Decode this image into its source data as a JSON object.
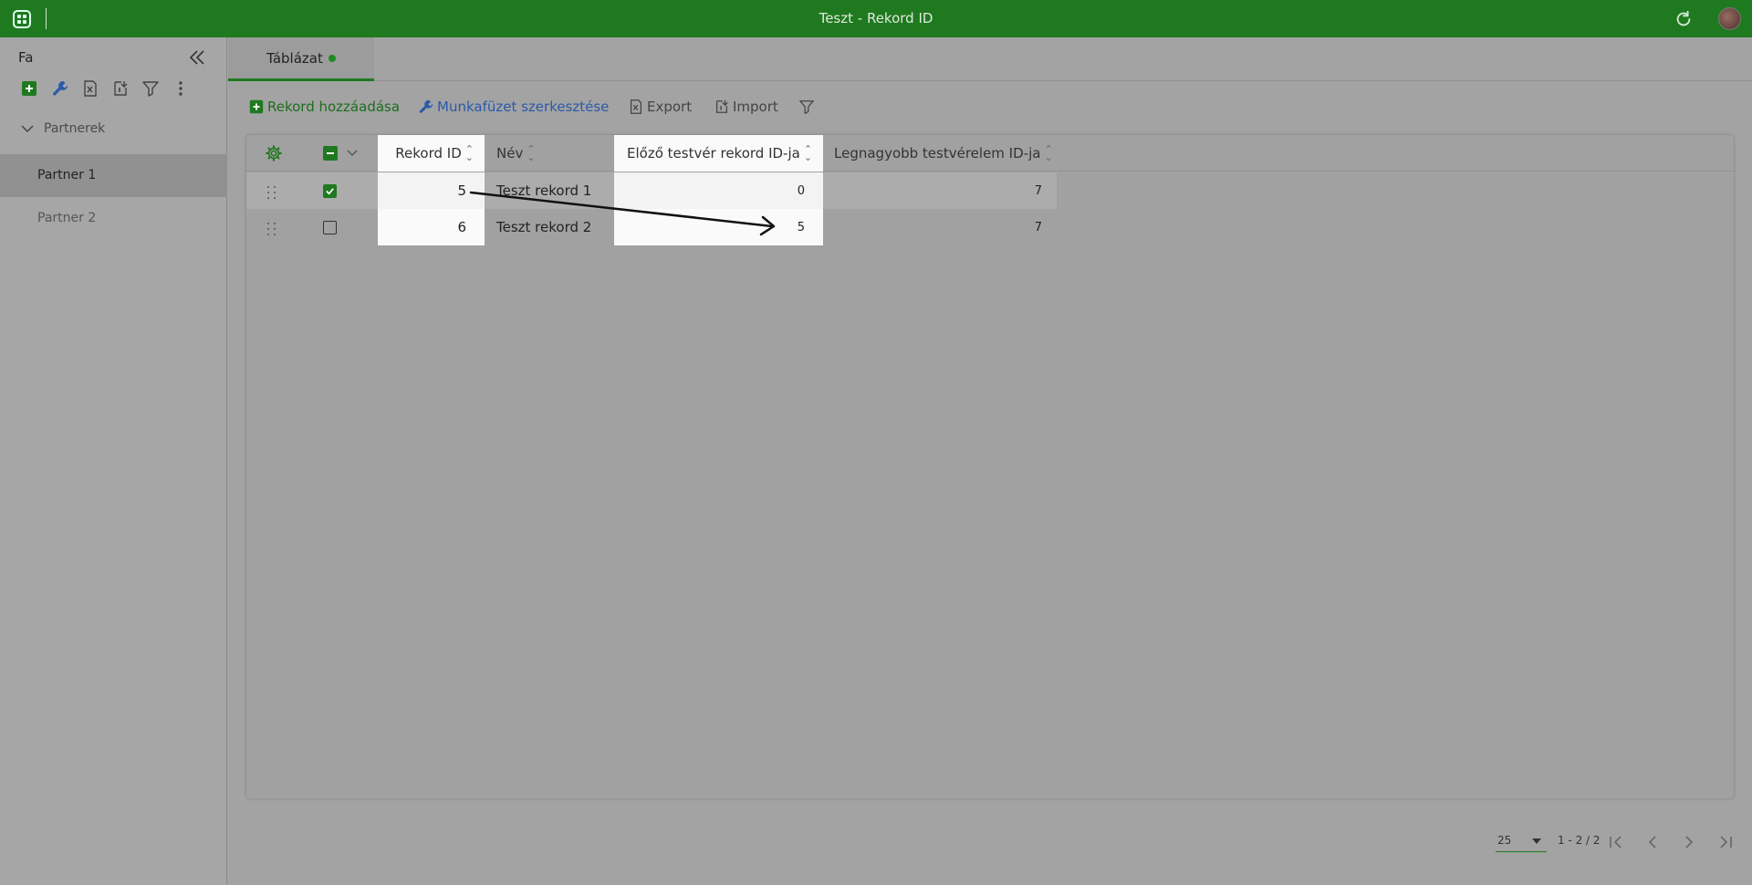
{
  "app": {
    "title": "Teszt - Rekord ID"
  },
  "sidebar": {
    "title": "Fa",
    "group": {
      "label": "Partnerek",
      "expanded": true
    },
    "items": [
      {
        "label": "Partner 1",
        "active": true
      },
      {
        "label": "Partner 2",
        "active": false
      }
    ],
    "tools": [
      "add-icon",
      "wrench-icon",
      "excel-export-icon",
      "import-icon",
      "filter-icon",
      "more-vert-icon"
    ]
  },
  "tabs": [
    {
      "label": "Táblázat",
      "active": true,
      "status": "green-dot"
    }
  ],
  "toolbar": {
    "add_label": "Rekord hozzáadása",
    "edit_label": "Munkafüzet szerkesztése",
    "export_label": "Export",
    "import_label": "Import"
  },
  "table": {
    "columns": [
      "Rekord ID",
      "Név",
      "Előző testvér rekord ID-ja",
      "Legnagyobb testvérelem ID-ja"
    ],
    "rows": [
      {
        "selected": true,
        "id": "5",
        "name": "Teszt rekord 1",
        "prev_sibling": "0",
        "max_sibling": "7"
      },
      {
        "selected": false,
        "id": "6",
        "name": "Teszt rekord 2",
        "prev_sibling": "5",
        "max_sibling": "7"
      }
    ]
  },
  "pagination": {
    "page_size": "25",
    "range": "1 - 2 / 2"
  },
  "colors": {
    "brand": "#1f7a1f",
    "link_blue": "#2b5aa8",
    "highlight": "#fafafa"
  }
}
